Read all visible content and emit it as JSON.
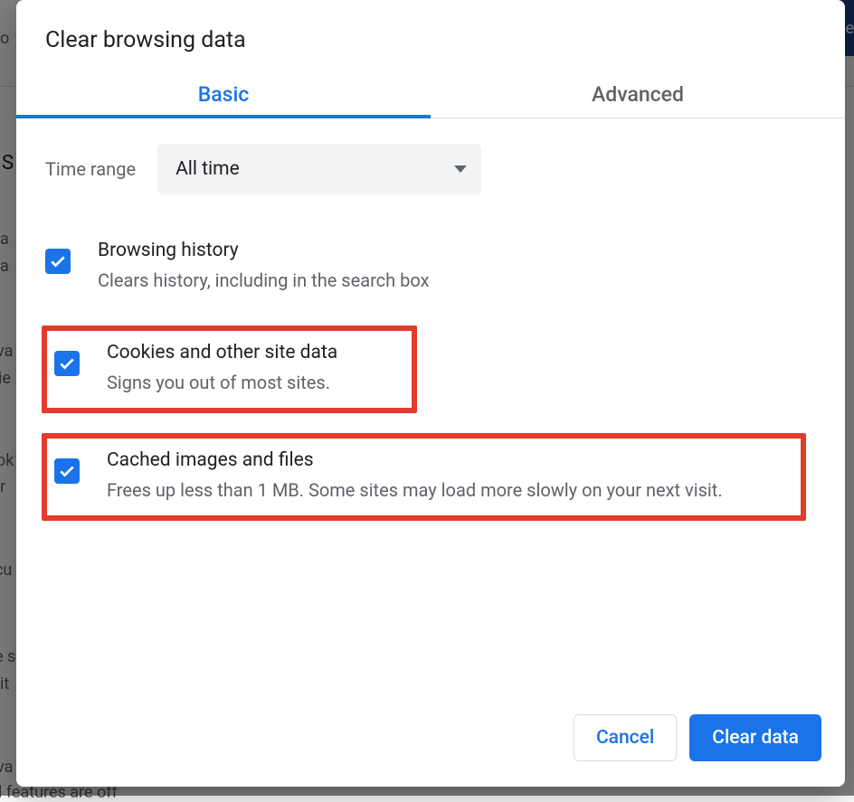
{
  "dialog": {
    "title": "Clear browsing data",
    "tabs": {
      "basic": "Basic",
      "advanced": "Advanced"
    },
    "time_range": {
      "label": "Time range",
      "value": "All time"
    },
    "options": {
      "browsing_history": {
        "title": "Browsing history",
        "desc": "Clears history, including in the search box"
      },
      "cookies": {
        "title": "Cookies and other site data",
        "desc": "Signs you out of most sites."
      },
      "cache": {
        "title": "Cached images and files",
        "desc": "Frees up less than 1 MB. Some sites may load more slowly on your next visit."
      }
    },
    "buttons": {
      "cancel": "Cancel",
      "clear": "Clear data"
    }
  },
  "background": {
    "top_right": "e",
    "frag_o": "o",
    "frag_s": "S",
    "frag_a1": "a",
    "frag_a2": "a",
    "frag_va": "va",
    "frag_ie": "ie",
    "frag_ok": "ok",
    "frag_r": "r",
    "frag_cu": "cu",
    "frag_es": "e s",
    "frag_it": "it",
    "frag_va2": "va",
    "frag_off": "l features are off"
  }
}
